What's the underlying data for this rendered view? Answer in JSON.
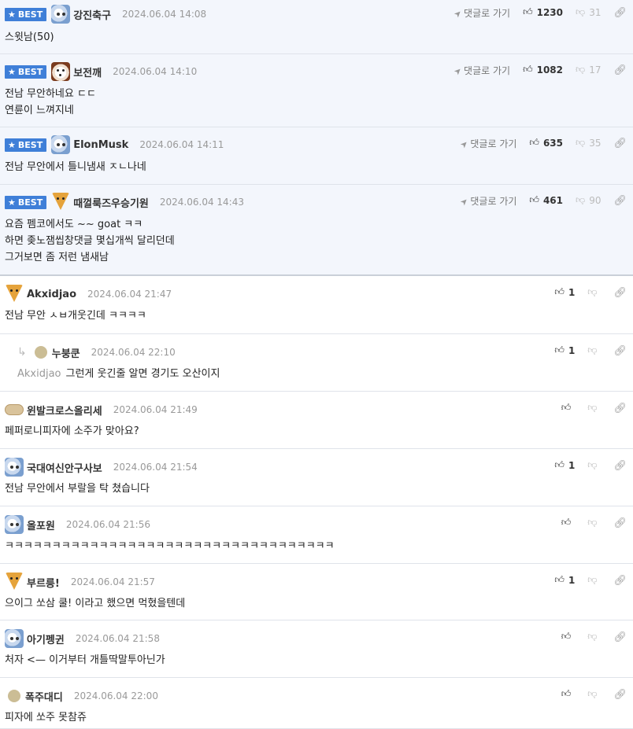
{
  "labels": {
    "best": "BEST",
    "goto": "댓글로 가기"
  },
  "icons": {
    "star": "star-icon",
    "goto": "send-arrow-icon",
    "like": "thumbs-up-icon",
    "dislike": "thumbs-down-icon",
    "link": "link-icon",
    "reply": "reply-arrow-icon"
  },
  "colors": {
    "best_badge": "#3f7fd8",
    "best_bg": "#f3f6fc"
  },
  "best_comments": [
    {
      "nick": "강진축구",
      "date": "2024.06.04 14:08",
      "likes": "1230",
      "dislikes": "31",
      "lines": [
        "스윗남(50)"
      ]
    },
    {
      "nick": "보전깨",
      "date": "2024.06.04 14:10",
      "likes": "1082",
      "dislikes": "17",
      "lines": [
        "전남 무안하네요 ㄷㄷ",
        "연륜이 느껴지네"
      ]
    },
    {
      "nick": "ElonMusk",
      "date": "2024.06.04 14:11",
      "likes": "635",
      "dislikes": "35",
      "lines": [
        "전남 무안에서 틀니냄새 ㅈㄴ나네"
      ]
    },
    {
      "nick": "때껄룩즈우승기원",
      "date": "2024.06.04 14:43",
      "likes": "461",
      "dislikes": "90",
      "lines": [
        "요즘 펨코에서도 ~~ goat ㅋㅋ",
        "하면 좆노잼씹창댓글 몇십개씩 달리던데",
        "그거보면 좀 저런 냄새남"
      ]
    }
  ],
  "comments": [
    {
      "nick": "Akxidjao",
      "date": "2024.06.04 21:47",
      "likes": "1",
      "dislikes": "",
      "mention": "",
      "lines": [
        "전남 무안 ㅅㅂ개웃긴데 ㅋㅋㅋㅋ"
      ]
    },
    {
      "nick": "누붕쿤",
      "date": "2024.06.04 22:10",
      "likes": "1",
      "dislikes": "",
      "mention": "Akxidjao",
      "lines": [
        "그런게 웃긴줄 알면 경기도 오산이지"
      ]
    },
    {
      "nick": "윈발크로스올리세",
      "date": "2024.06.04 21:49",
      "likes": "",
      "dislikes": "",
      "mention": "",
      "lines": [
        "페퍼로니피자에 소주가 맞아요?"
      ]
    },
    {
      "nick": "국대여신안구사보",
      "date": "2024.06.04 21:54",
      "likes": "1",
      "dislikes": "",
      "mention": "",
      "lines": [
        "전남 무안에서 부랄을 탁 쳤습니다"
      ]
    },
    {
      "nick": "올포원",
      "date": "2024.06.04 21:56",
      "likes": "",
      "dislikes": "",
      "mention": "",
      "lines": [
        "ㅋㅋㅋㅋㅋㅋㅋㅋㅋㅋㅋㅋㅋㅋㅋㅋㅋㅋㅋㅋㅋㅋㅋㅋㅋㅋㅋㅋㅋㅋㅋㅋㅋㅋㅋ"
      ]
    },
    {
      "nick": "부르릉!",
      "date": "2024.06.04 21:57",
      "likes": "1",
      "dislikes": "",
      "mention": "",
      "lines": [
        "으이그 쏘삼 쿨! 이라고 했으면 먹혔을텐데"
      ]
    },
    {
      "nick": "아기펭귄",
      "date": "2024.06.04 21:58",
      "likes": "",
      "dislikes": "",
      "mention": "",
      "lines": [
        "처자 <— 이거부터 개틀딱말투아닌가"
      ]
    },
    {
      "nick": "폭주대디",
      "date": "2024.06.04 22:00",
      "likes": "",
      "dislikes": "",
      "mention": "",
      "lines": [
        "피자에 쏘주 못참쥬"
      ]
    }
  ]
}
